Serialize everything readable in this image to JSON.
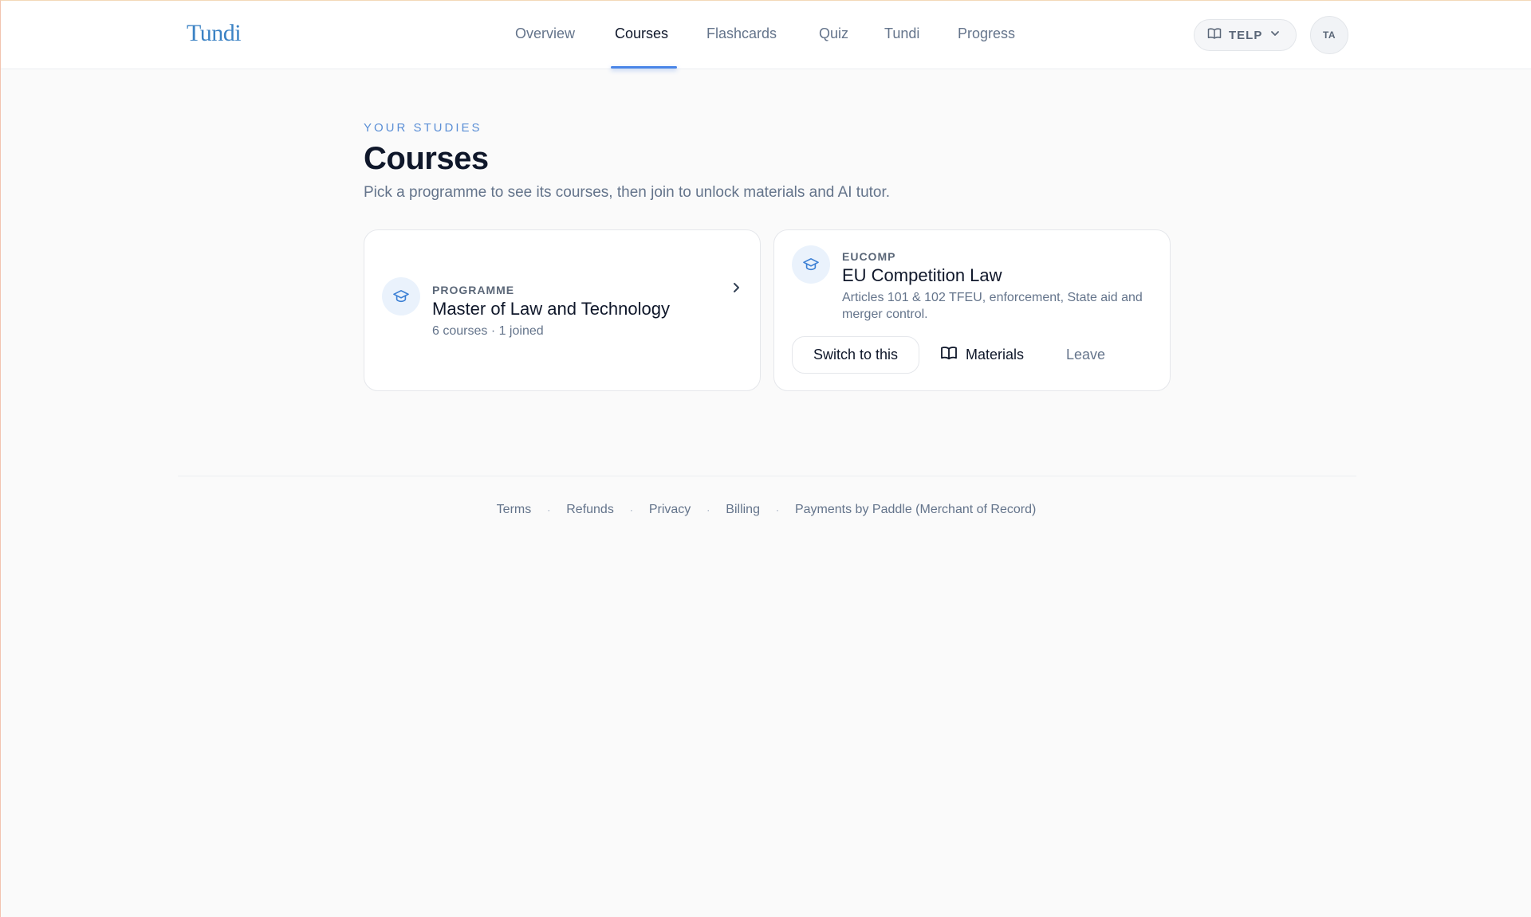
{
  "header": {
    "logo": "Tundi",
    "nav": [
      {
        "label": "Overview",
        "active": false
      },
      {
        "label": "Courses",
        "active": true
      },
      {
        "label": "Flashcards",
        "active": false
      },
      {
        "label": "Quiz",
        "active": false
      },
      {
        "label": "Tundi",
        "active": false
      },
      {
        "label": "Progress",
        "active": false
      }
    ],
    "programme_selector": {
      "label": "TELP",
      "icon": "book-open-icon",
      "chevron": "chevron-down-icon"
    },
    "avatar_initials": "TA"
  },
  "main": {
    "eyebrow": "YOUR STUDIES",
    "title": "Courses",
    "subtitle": "Pick a programme to see its courses, then join to unlock materials and AI tutor.",
    "programme_card": {
      "icon": "graduation-cap-icon",
      "kicker": "PROGRAMME",
      "title": "Master of Law and Technology",
      "meta": "6 courses · 1 joined"
    },
    "course_card": {
      "icon": "graduation-cap-icon",
      "code": "EUCOMP",
      "title": "EU Competition Law",
      "description": "Articles 101 & 102 TFEU, enforcement, State aid and merger control.",
      "actions": {
        "switch": "Switch to this",
        "materials": "Materials",
        "leave": "Leave"
      }
    }
  },
  "footer": {
    "links": [
      "Terms",
      "Refunds",
      "Privacy",
      "Billing",
      "Payments by Paddle (Merchant of Record)"
    ]
  },
  "colors": {
    "accent": "#4a86e8",
    "logo": "#3b82c4",
    "eyebrow": "#5b8fd6",
    "muted_text": "#64748b",
    "background": "#fafafa"
  }
}
